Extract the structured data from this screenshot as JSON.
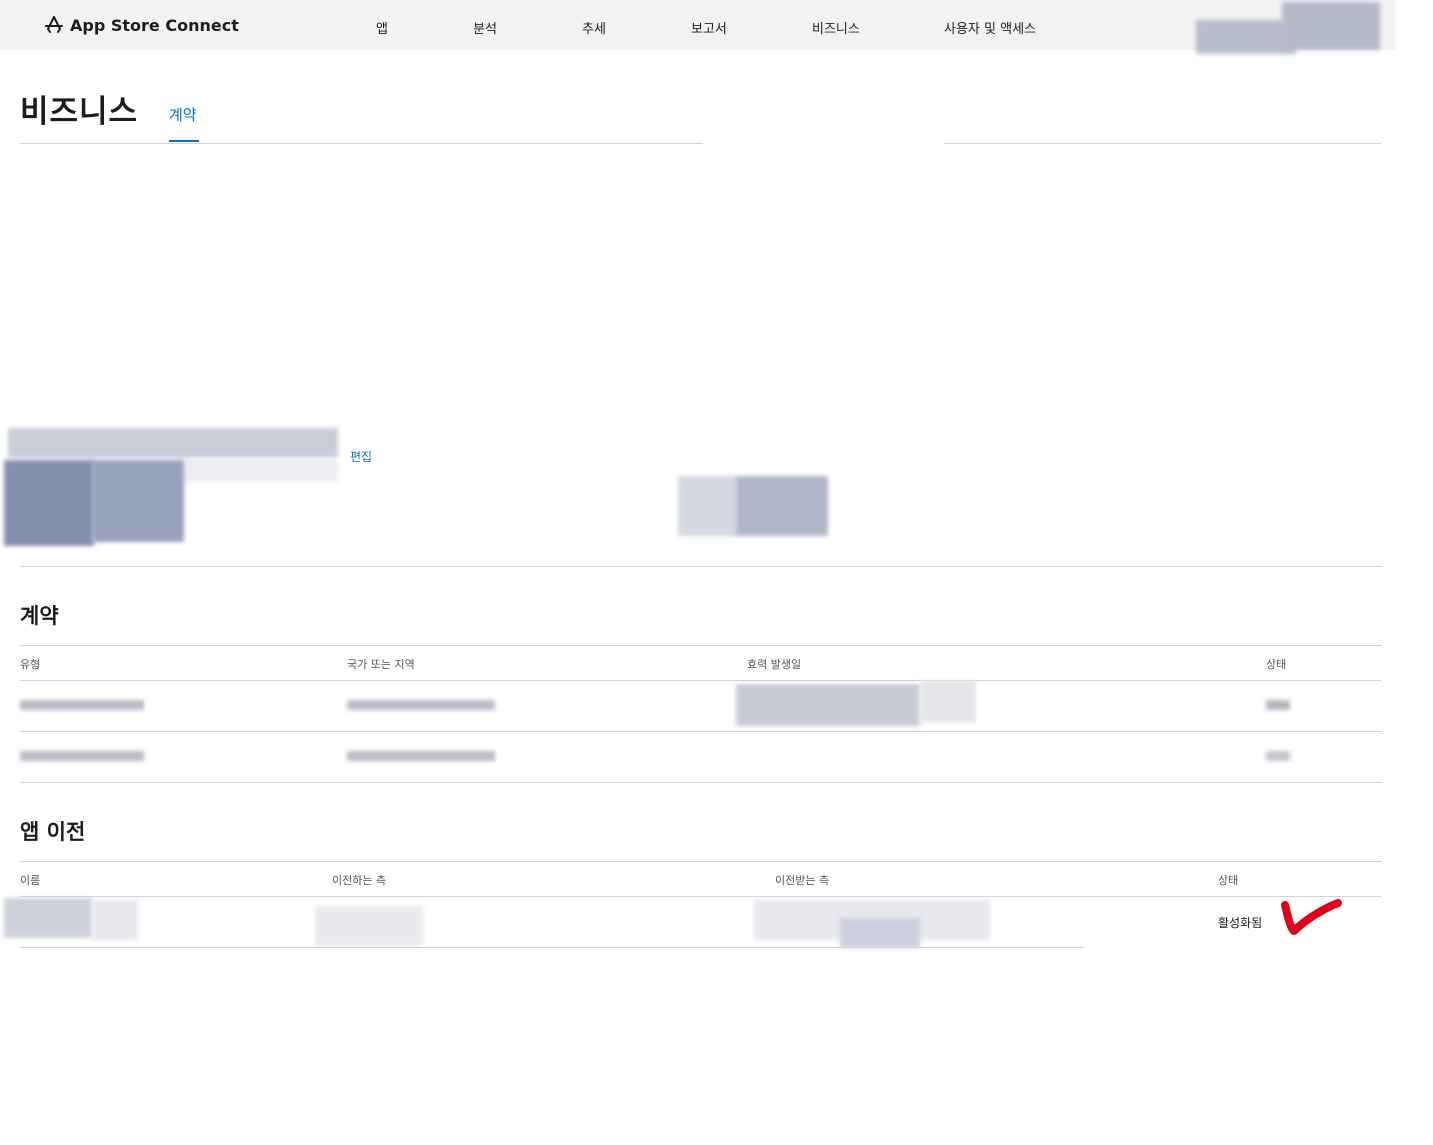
{
  "header": {
    "app_name": "App Store Connect",
    "nav": [
      "앱",
      "분석",
      "추세",
      "보고서",
      "비즈니스",
      "사용자 및 액세스"
    ],
    "icons": {
      "logo": "app-store-icon"
    }
  },
  "page": {
    "title": "비즈니스",
    "tabs": [
      {
        "label": "계약",
        "active": true
      }
    ]
  },
  "account": {
    "edit_label": "편집"
  },
  "contracts": {
    "title": "계약",
    "columns": [
      "유형",
      "국가 또는 지역",
      "효력 발생일",
      "상태"
    ]
  },
  "transfers": {
    "title": "앱 이전",
    "columns": [
      "이름",
      "이전하는 측",
      "이전받는 측",
      "상태"
    ],
    "rows": [
      {
        "status": "활성화됨"
      }
    ]
  },
  "colors": {
    "accent": "#0070c9",
    "checkmark": "#e0001a"
  }
}
